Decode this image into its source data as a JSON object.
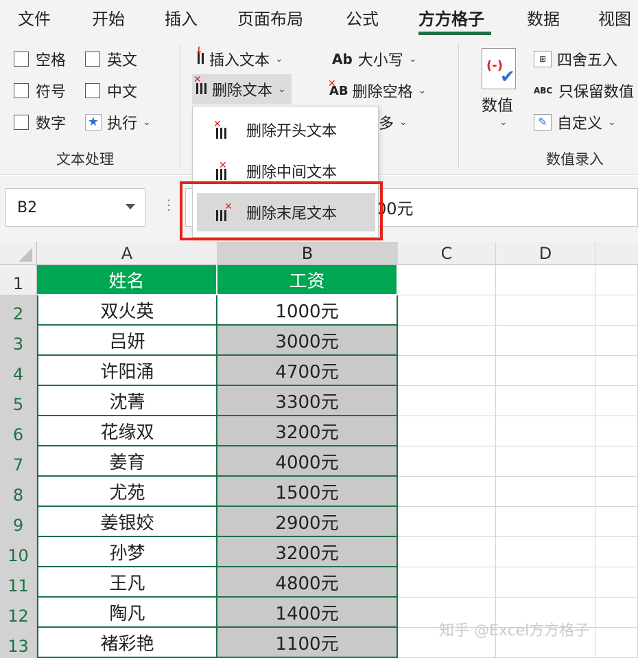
{
  "tabs": [
    "文件",
    "开始",
    "插入",
    "页面布局",
    "公式",
    "方方格子",
    "数据",
    "视图"
  ],
  "active_tab": "方方格子",
  "ribbon": {
    "text_group": {
      "checkboxes": [
        "空格",
        "英文",
        "符号",
        "中文",
        "数字"
      ],
      "execute_label": "执行",
      "group_label": "文本处理"
    },
    "insert_text": "插入文本",
    "delete_text": "删除文本",
    "case_label": "大小写",
    "delete_space": "删除空格",
    "more_partial": "多",
    "number_label": "数值",
    "round_label": "四舍五入",
    "keep_number": "只保留数值",
    "custom_label": "自定义",
    "group_number_label": "数值录入"
  },
  "dropdown": {
    "items": [
      "删除开头文本",
      "删除中间文本",
      "删除末尾文本"
    ],
    "highlighted": "删除末尾文本"
  },
  "formula_bar": {
    "name_box": "B2",
    "value_visible": "00元"
  },
  "grid": {
    "columns": [
      "A",
      "B",
      "C",
      "D"
    ],
    "header_row": [
      "姓名",
      "工资"
    ],
    "rows": [
      {
        "num": "1"
      },
      {
        "num": "2",
        "a": "双火英",
        "b": "1000元"
      },
      {
        "num": "3",
        "a": "吕妍",
        "b": "3000元"
      },
      {
        "num": "4",
        "a": "许阳涌",
        "b": "4700元"
      },
      {
        "num": "5",
        "a": "沈菁",
        "b": "3300元"
      },
      {
        "num": "6",
        "a": "花缘双",
        "b": "3200元"
      },
      {
        "num": "7",
        "a": "姜育",
        "b": "4000元"
      },
      {
        "num": "8",
        "a": "尤苑",
        "b": "1500元"
      },
      {
        "num": "9",
        "a": "姜银姣",
        "b": "2900元"
      },
      {
        "num": "10",
        "a": "孙梦",
        "b": "3200元"
      },
      {
        "num": "11",
        "a": "王凡",
        "b": "4800元"
      },
      {
        "num": "12",
        "a": "陶凡",
        "b": "1400元"
      },
      {
        "num": "13",
        "a": "褚彩艳",
        "b": "1100元"
      }
    ]
  },
  "watermark": "知乎 @Excel方方格子",
  "colors": {
    "accent": "#1e7145",
    "header_fill": "#00a651",
    "highlight_border": "#e2231a"
  }
}
